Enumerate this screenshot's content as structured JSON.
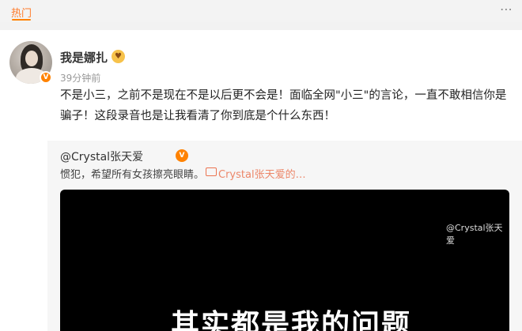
{
  "header": {
    "hot_tab": "热门"
  },
  "post": {
    "username": "我是娜扎",
    "timestamp": "39分钟前",
    "text": "不是小三，之前不是现在不是以后更不会是！面临全网\"小三\"的言论，一直不敢相信你是骗子！这段录音也是让我看清了你到底是个什么东西！"
  },
  "repost": {
    "author": "@Crystal张天爱",
    "text": "惯犯，希望所有女孩擦亮眼睛。",
    "link_text": "Crystal张天爱的…"
  },
  "video": {
    "watermark": "@Crystal张天爱",
    "subtitle": "其实都是我的问题"
  },
  "colors": {
    "accent": "#ff8200",
    "link": "#eb7350"
  }
}
